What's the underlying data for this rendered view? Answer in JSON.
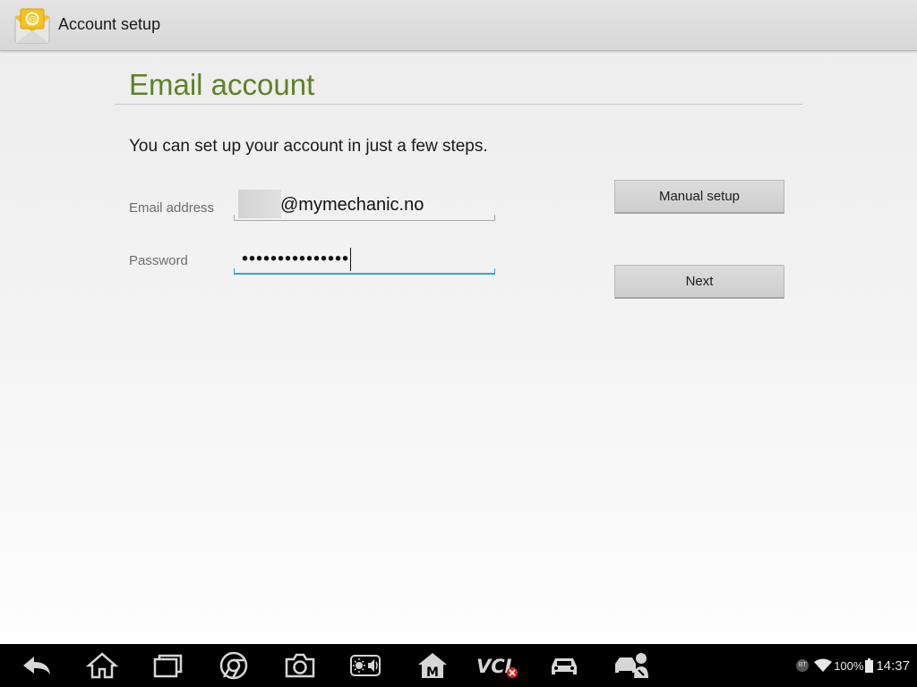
{
  "actionbar": {
    "title": "Account setup",
    "icon": "email-app-icon"
  },
  "form": {
    "heading": "Email account",
    "intro": "You can set up your account in just a few steps.",
    "email_label": "Email address",
    "email_value": "@mymechanic.no",
    "password_label": "Password",
    "password_value": "•••••••••••••••"
  },
  "buttons": {
    "manual_setup": "Manual setup",
    "next": "Next"
  },
  "navbar": {
    "icons": [
      "back-icon",
      "home-icon",
      "recent-apps-icon",
      "chrome-icon",
      "camera-icon",
      "display-volume-icon",
      "maxifix-icon",
      "vci-icon",
      "vehicle-icon",
      "remote-support-icon"
    ],
    "vci_label": "VCI"
  },
  "status": {
    "battery_percent": "100%",
    "time": "14:37",
    "bt_label": "BT"
  },
  "colors": {
    "heading_green": "#5e8226",
    "focus_blue": "#33a5d8"
  }
}
